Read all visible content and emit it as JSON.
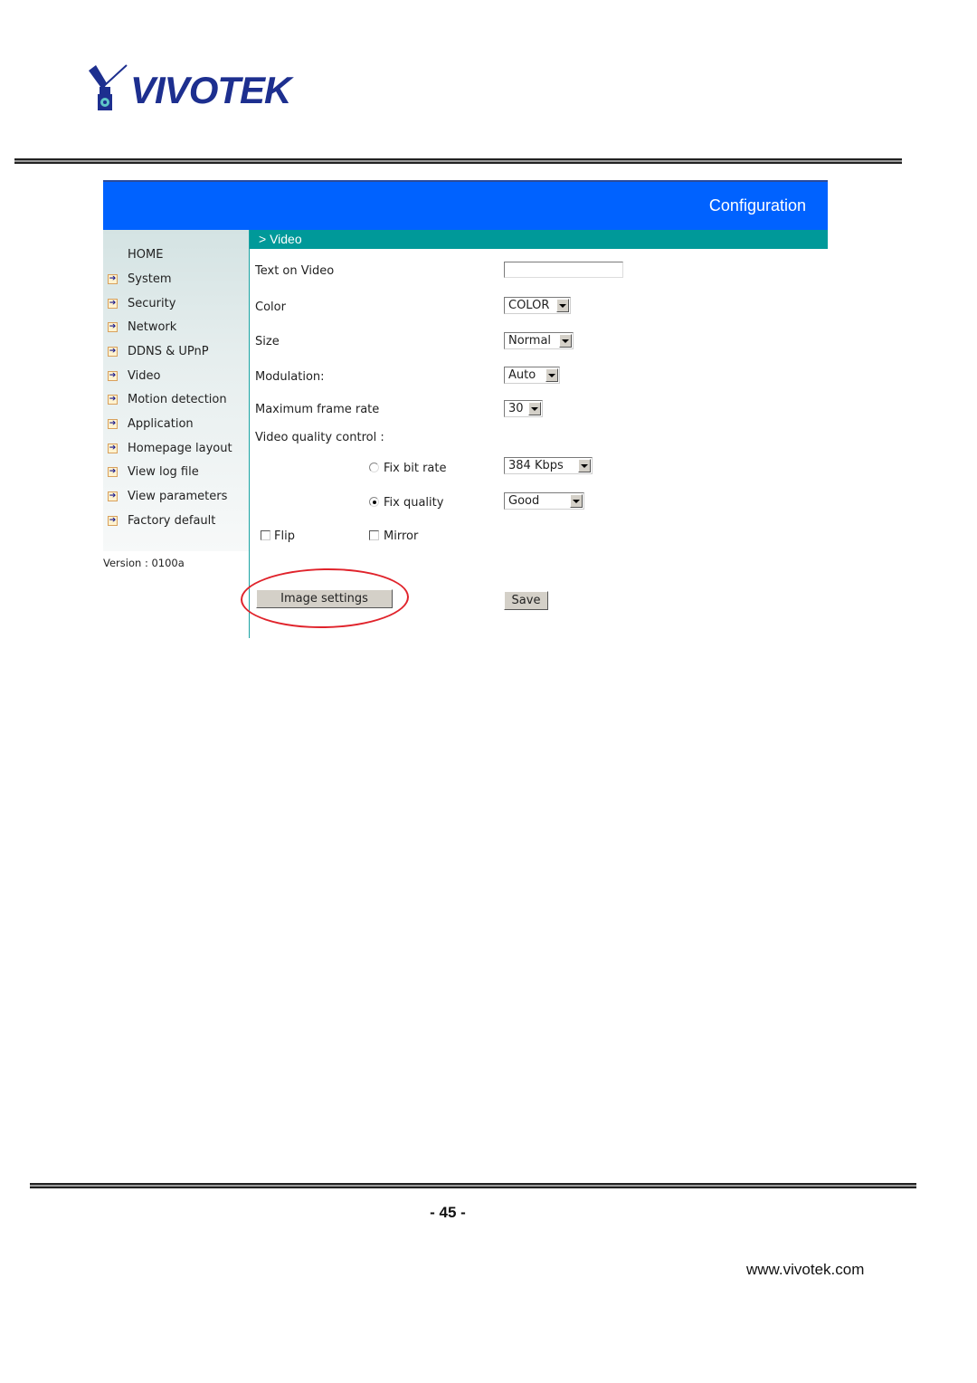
{
  "logo": {
    "brand": "VIVOTEK"
  },
  "header": {
    "title": "Configuration"
  },
  "sidebar": {
    "home": "HOME",
    "items": [
      {
        "label": "System"
      },
      {
        "label": "Security"
      },
      {
        "label": "Network"
      },
      {
        "label": "DDNS & UPnP"
      },
      {
        "label": "Video"
      },
      {
        "label": "Motion detection"
      },
      {
        "label": "Application"
      },
      {
        "label": "Homepage layout"
      },
      {
        "label": "View log file"
      },
      {
        "label": "View parameters"
      },
      {
        "label": "Factory default"
      }
    ],
    "version": "Version : 0100a"
  },
  "section": {
    "title": "> Video"
  },
  "form": {
    "text_on_video": {
      "label": "Text on Video",
      "value": ""
    },
    "color": {
      "label": "Color",
      "value": "COLOR"
    },
    "size": {
      "label": "Size",
      "value": "Normal"
    },
    "modulation": {
      "label": "Modulation:",
      "value": "Auto"
    },
    "max_frame_rate": {
      "label": "Maximum frame rate",
      "value": "30"
    },
    "quality_control": {
      "label": "Video quality control :",
      "fix_bit_rate": {
        "label": "Fix bit rate",
        "checked": false,
        "value": "384 Kbps"
      },
      "fix_quality": {
        "label": "Fix quality",
        "checked": true,
        "value": "Good"
      }
    },
    "flip": {
      "label": "Flip",
      "checked": false
    },
    "mirror": {
      "label": "Mirror",
      "checked": false
    },
    "image_settings_button": "Image settings",
    "save_button": "Save"
  },
  "annotation": {
    "color": "#e0232b",
    "target": "Image settings"
  },
  "colors": {
    "banner": "#0062ff",
    "section_bar": "#009999"
  },
  "footer": {
    "page_number": "- 45 -",
    "website": "www.vivotek.com"
  }
}
